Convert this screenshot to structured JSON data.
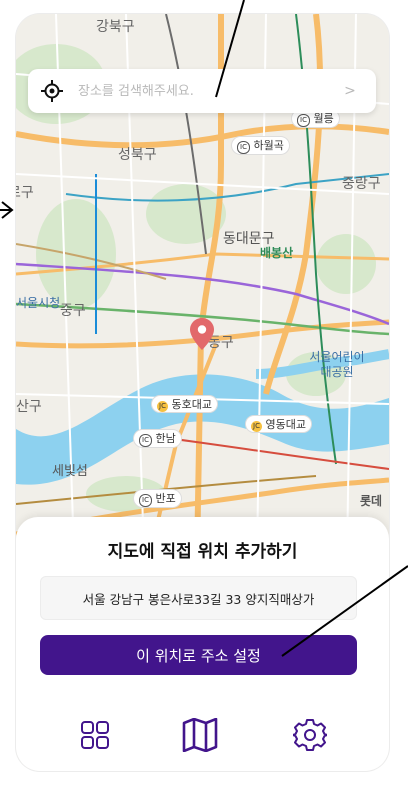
{
  "colors": {
    "accent": "#42158c",
    "pin": "#e2696b"
  },
  "map": {
    "labels": {
      "gangbuk": "강북구",
      "seongbuk": "성북구",
      "jungnang": "중랑구",
      "dongdaemun": "동대문구",
      "baebongsan": "배봉산",
      "jung": "중구",
      "seoul_city_hall": "서울시청",
      "jung_gu_right": "중구",
      "dong": "동구",
      "seoul_childrens_park": "서울어린이 대공원",
      "san_gu": "산구",
      "sebitseom": "세빛섬",
      "lotte": "롯데",
      "ru_gu": "로구"
    },
    "badges": {
      "wolgye": "월릉",
      "hawolgok": "하월곡",
      "dongho": "동호대교",
      "yeongdong": "영동대교",
      "hannam": "한남",
      "banpo": "반포"
    }
  },
  "search": {
    "placeholder": "장소를 검색해주세요.",
    "locate_icon": "crosshair-icon",
    "submit_icon": "chevron-right-icon",
    "submit_glyph": ">"
  },
  "sheet": {
    "title": "지도에 직접 위치 추가하기",
    "address": "서울 강남구 봉은사로33길 33 양지직매상가",
    "cta_label": "이 위치로 주소 설정"
  },
  "nav": {
    "items": [
      {
        "icon": "grid-icon"
      },
      {
        "icon": "map-icon",
        "active": true
      },
      {
        "icon": "gear-icon"
      }
    ]
  }
}
